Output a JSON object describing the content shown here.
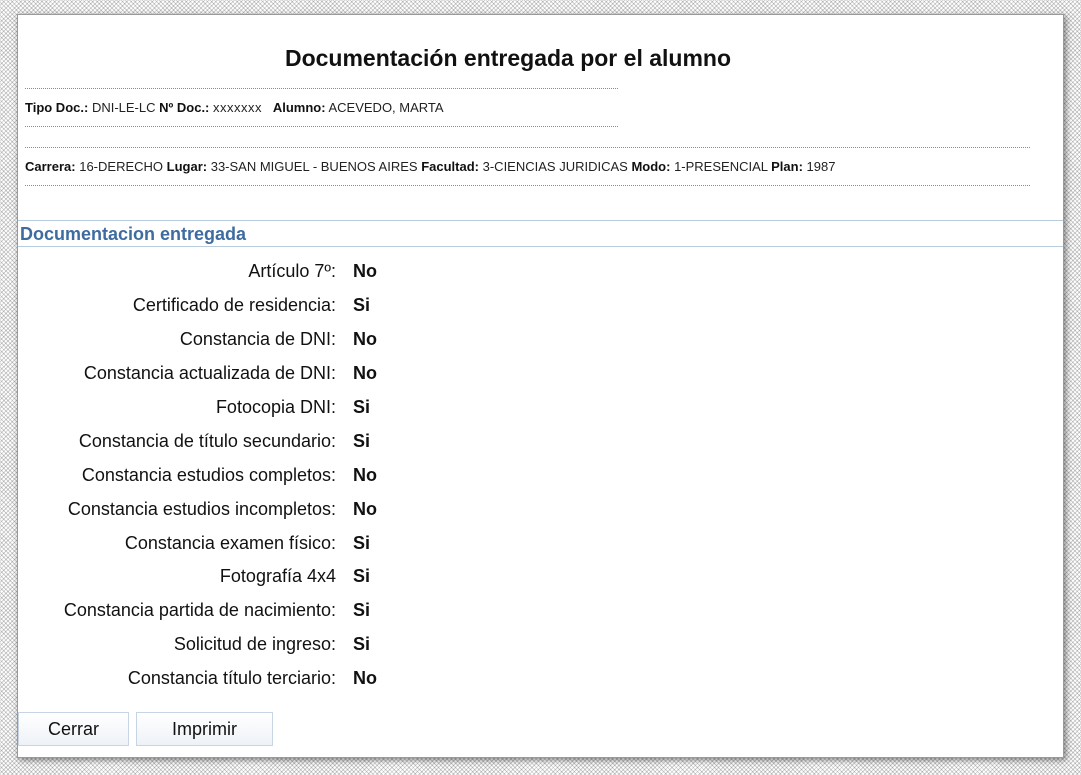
{
  "title": "Documentación entregada por el alumno",
  "student": {
    "tipo_doc_label": "Tipo Doc.:",
    "tipo_doc_value": "DNI-LE-LC",
    "nro_doc_label": "Nº Doc.:",
    "nro_doc_value": "xxxxxxx",
    "alumno_label": "Alumno:",
    "alumno_value": "ACEVEDO, MARTA"
  },
  "career": {
    "carrera_label": "Carrera:",
    "carrera_value": "16-DERECHO",
    "lugar_label": "Lugar:",
    "lugar_value": "33-SAN MIGUEL - BUENOS AIRES",
    "facultad_label": "Facultad:",
    "facultad_value": "3-CIENCIAS JURIDICAS",
    "modo_label": "Modo:",
    "modo_value": "1-PRESENCIAL",
    "plan_label": "Plan:",
    "plan_value": "1987"
  },
  "section_title": "Documentacion entregada",
  "documents": [
    {
      "label": "Artículo 7º:",
      "value": "No"
    },
    {
      "label": "Certificado de residencia:",
      "value": "Si"
    },
    {
      "label": "Constancia de DNI:",
      "value": "No"
    },
    {
      "label": "Constancia actualizada de DNI:",
      "value": "No"
    },
    {
      "label": "Fotocopia DNI:",
      "value": "Si"
    },
    {
      "label": "Constancia de título secundario:",
      "value": "Si"
    },
    {
      "label": "Constancia estudios completos:",
      "value": "No"
    },
    {
      "label": "Constancia estudios incompletos:",
      "value": "No"
    },
    {
      "label": "Constancia examen físico:",
      "value": "Si"
    },
    {
      "label": "Fotografía 4x4",
      "value": "Si"
    },
    {
      "label": "Constancia partida de nacimiento:",
      "value": "Si"
    },
    {
      "label": "Solicitud de ingreso:",
      "value": "Si"
    },
    {
      "label": "Constancia título terciario:",
      "value": "No"
    }
  ],
  "buttons": {
    "close_label": "Cerrar",
    "print_label": "Imprimir"
  }
}
